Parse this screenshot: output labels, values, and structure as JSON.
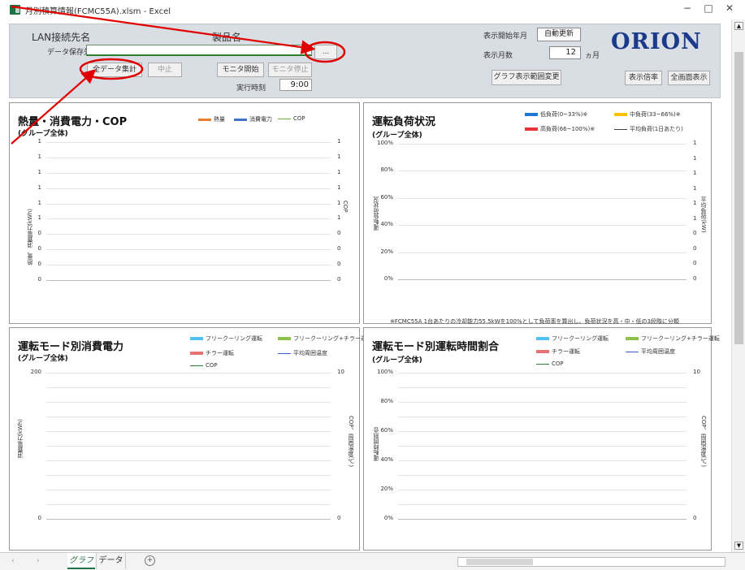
{
  "window": {
    "title": "月別積算情報(FCMC55A).xlsm - Excel",
    "minimize": "−",
    "restore": "□",
    "close": "✕"
  },
  "panel": {
    "lan_label": "LAN接続先名",
    "product_label": "製品名",
    "save_label": "データ保存先",
    "save_value": "",
    "browse_label": "...",
    "aggregate_label": "全データ集計",
    "stop_label": "中止",
    "monitor_start_label": "モニタ開始",
    "monitor_stop_label": "モニタ停止",
    "exec_time_label": "実行時刻",
    "exec_time_value": "9:00",
    "start_month_label": "表示開始年月",
    "start_month_value": "自動更新",
    "months_label": "表示月数",
    "months_value": "12",
    "months_unit": "ヵ月",
    "range_change_label": "グラフ表示範囲変更",
    "logo": "ORION",
    "scale_label": "表示倍率",
    "fullscreen_label": "全画面表示"
  },
  "charts": {
    "heat": {
      "title": "熱量・消費電力・COP",
      "subtitle": "(グループ全体)",
      "legend": [
        {
          "name": "熱量",
          "color": "#ed7d31"
        },
        {
          "name": "消費電力",
          "color": "#4472c4"
        },
        {
          "name": "COP",
          "color": "#70ad47"
        }
      ],
      "left_ticks": [
        "1",
        "1",
        "1",
        "1",
        "1",
        "1",
        "0",
        "0",
        "0",
        "0"
      ],
      "right_ticks": [
        "1",
        "1",
        "1",
        "1",
        "1",
        "1",
        "0",
        "0",
        "0",
        "0"
      ],
      "ylabel": "熱量、消費電力(kWh)",
      "y2label": "COP"
    },
    "load": {
      "title": "運転負荷状況",
      "subtitle": "(グループ全体)",
      "legend": [
        {
          "name": "低負荷(0~33%)※",
          "color": "#1f77d4"
        },
        {
          "name": "中負荷(33~66%)※",
          "color": "#ffc000"
        },
        {
          "name": "高負荷(66~100%)※",
          "color": "#e8323c"
        },
        {
          "name": "平均負荷(1日あたり)",
          "color": "#404040"
        }
      ],
      "left_ticks": [
        "100%",
        "80%",
        "60%",
        "40%",
        "20%",
        "0%"
      ],
      "right_ticks": [
        "1",
        "1",
        "1",
        "1",
        "1",
        "1",
        "0",
        "0",
        "0",
        "0"
      ],
      "ylabel": "運転負荷状況",
      "y2label": "平均負荷(kW)",
      "note": "※FCMC55A 1台あたりの冷却能力55.5kWを100%として負荷率を算出し、負荷状況を高・中・低の3段階に分類"
    },
    "mode_power": {
      "title": "運転モード別消費電力",
      "subtitle": "(グループ全体)",
      "legend": [
        {
          "name": "フリークーリング運転",
          "color": "#4fc3f7"
        },
        {
          "name": "フリークーリング+チラー運転",
          "color": "#8bc34a"
        },
        {
          "name": "チラー運転",
          "color": "#e57373"
        },
        {
          "name": "平均周囲温度",
          "color": "#3a5fcd"
        },
        {
          "name": "COP",
          "color": "#2e7d32"
        }
      ],
      "left_ticks": [
        "200",
        "0"
      ],
      "right_ticks": [
        "10",
        "0"
      ],
      "ylabel": "消費電力(kWh)",
      "y2label": "COP、周囲温度(℃)"
    },
    "mode_time": {
      "title": "運転モード別運転時間割合",
      "subtitle": "(グループ全体)",
      "legend": [
        {
          "name": "フリークーリング運転",
          "color": "#4fc3f7"
        },
        {
          "name": "フリークーリング+チラー運転",
          "color": "#8bc34a"
        },
        {
          "name": "チラー運転",
          "color": "#e57373"
        },
        {
          "name": "平均周囲温度",
          "color": "#3a5fcd"
        },
        {
          "name": "COP",
          "color": "#2e7d32"
        }
      ],
      "left_ticks": [
        "100%",
        "80%",
        "60%",
        "40%",
        "20%",
        "0%"
      ],
      "right_ticks": [
        "10",
        "0"
      ],
      "ylabel": "運転時間割合",
      "y2label": "COP、周囲温度(℃)"
    }
  },
  "tabs": {
    "graph": "グラフ",
    "data": "データ",
    "add": "+"
  },
  "annotation_color": "#e00000"
}
